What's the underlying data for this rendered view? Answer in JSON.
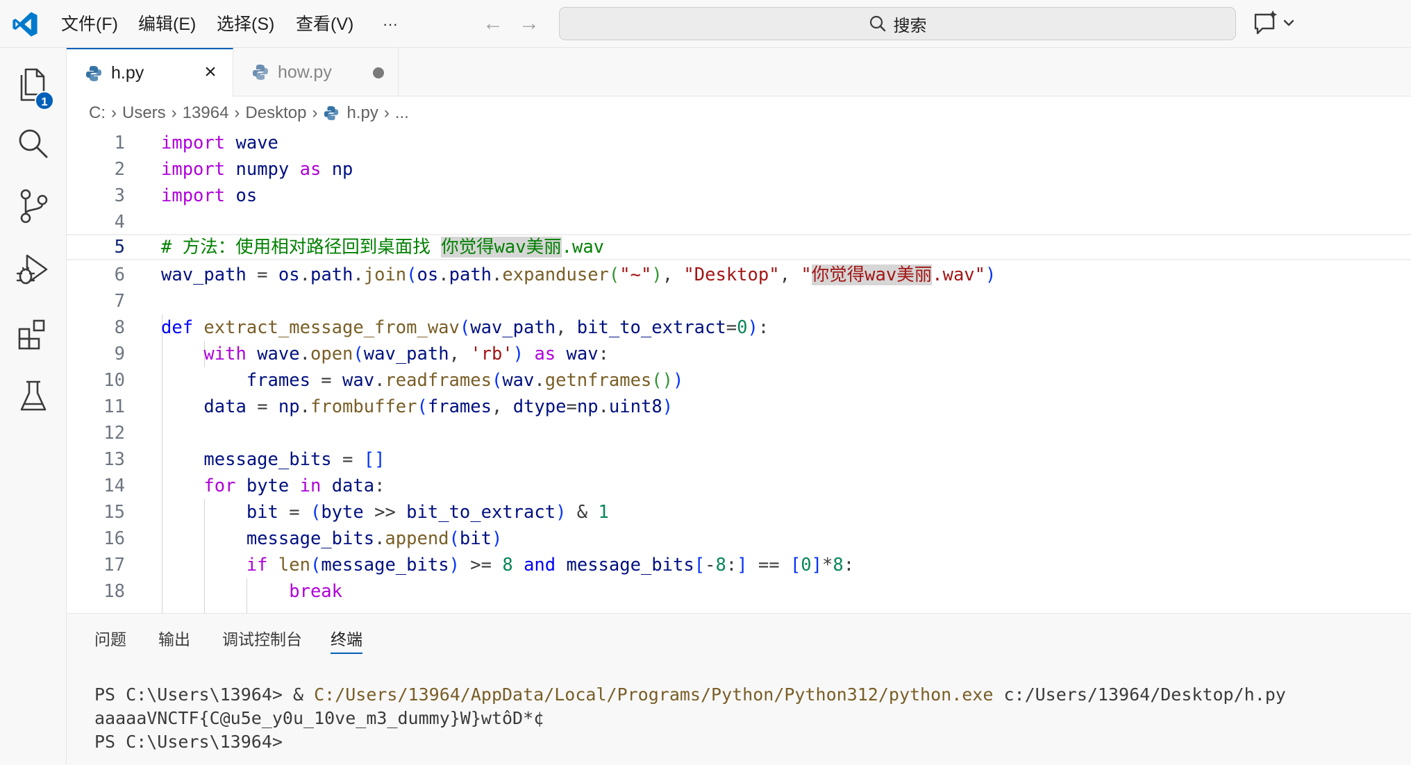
{
  "menu": {
    "file": "文件(F)",
    "edit": "编辑(E)",
    "selection": "选择(S)",
    "view": "查看(V)",
    "more": "···"
  },
  "search": {
    "label": "搜索"
  },
  "activity": {
    "explorer_badge": "1"
  },
  "tabs": [
    {
      "label": "h.py"
    },
    {
      "label": "how.py"
    }
  ],
  "breadcrumbs": [
    "C:",
    "Users",
    "13964",
    "Desktop",
    "h.py",
    "..."
  ],
  "editor": {
    "line_numbers": [
      "1",
      "2",
      "3",
      "4",
      "5",
      "6",
      "7",
      "8",
      "9",
      "10",
      "11",
      "12",
      "13",
      "14",
      "15",
      "16",
      "17",
      "18"
    ],
    "current_line": "5"
  },
  "panel": {
    "tabs": [
      "问题",
      "输出",
      "调试控制台",
      "终端"
    ],
    "active_tab": "终端"
  },
  "terminal": {
    "prompt1": "PS C:\\Users\\13964> & ",
    "python_path": "C:/Users/13964/AppData/Local/Programs/Python/Python312/python.exe",
    "script_arg": " c:/Users/13964/Desktop/h.py",
    "output": "aaaaaVNCTF{C@u5e_y0u_10ve_m3_dummy}W}wtôD*¢",
    "prompt2": "PS C:\\Users\\13964>"
  },
  "colors": {
    "accent": "#005fb8",
    "keyword": "#0000ff",
    "control_keyword": "#af00db",
    "function": "#795e26",
    "string": "#a31515",
    "number": "#098658",
    "comment": "#008000",
    "variable": "#001080"
  }
}
